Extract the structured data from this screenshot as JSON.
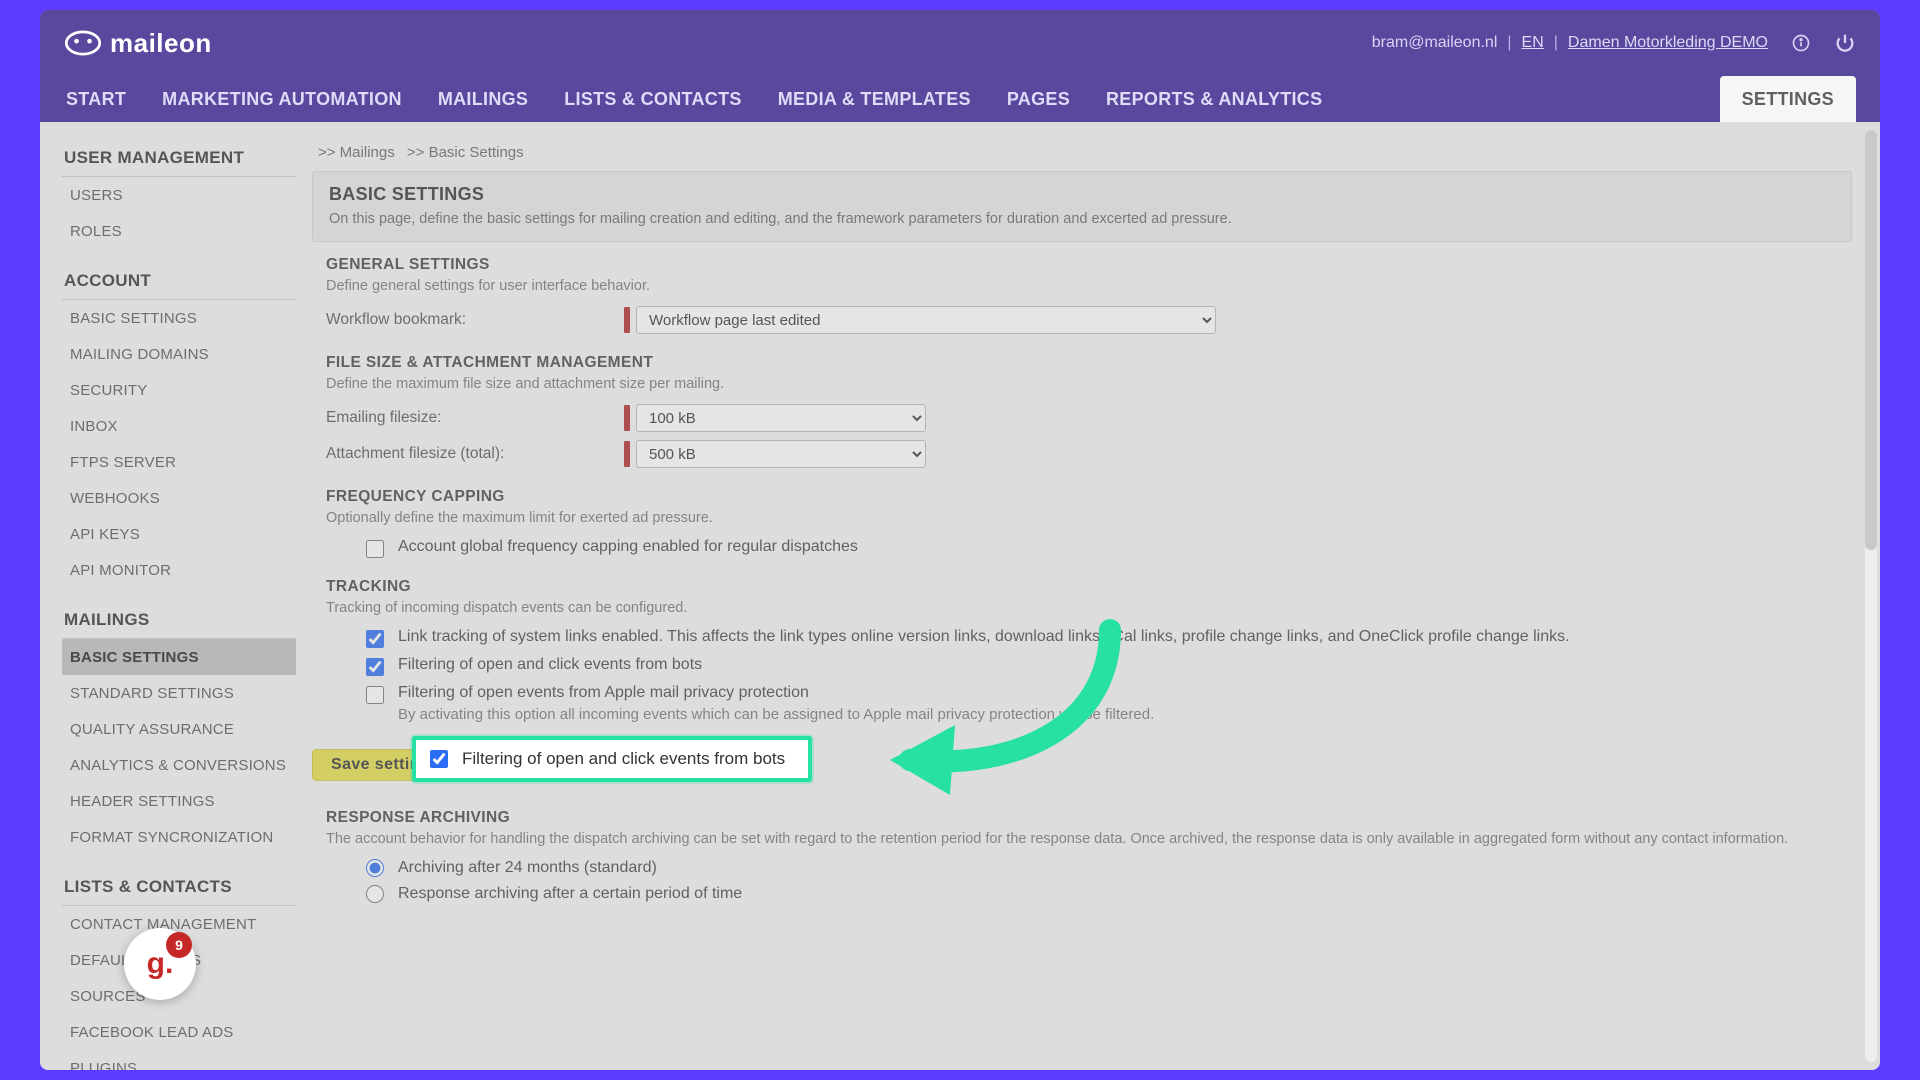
{
  "brand": {
    "name": "maileon"
  },
  "header": {
    "email": "bram@maileon.nl",
    "lang": "EN",
    "org": "Damen Motorkleding DEMO"
  },
  "nav": {
    "items": [
      "START",
      "MARKETING AUTOMATION",
      "MAILINGS",
      "LISTS & CONTACTS",
      "MEDIA & TEMPLATES",
      "PAGES",
      "REPORTS & ANALYTICS"
    ],
    "settings": "SETTINGS"
  },
  "sidebar": {
    "groups": [
      {
        "title": "USER MANAGEMENT",
        "items": [
          "USERS",
          "ROLES"
        ]
      },
      {
        "title": "ACCOUNT",
        "items": [
          "BASIC SETTINGS",
          "MAILING DOMAINS",
          "SECURITY",
          "INBOX",
          "FTPS SERVER",
          "WEBHOOKS",
          "API KEYS",
          "API MONITOR"
        ]
      },
      {
        "title": "MAILINGS",
        "items": [
          "BASIC SETTINGS",
          "STANDARD SETTINGS",
          "QUALITY ASSURANCE",
          "ANALYTICS & CONVERSIONS",
          "HEADER SETTINGS",
          "FORMAT SYNCRONIZATION"
        ],
        "active_index": 0
      },
      {
        "title": "LISTS & CONTACTS",
        "items": [
          "CONTACT MANAGEMENT",
          "DEFAULT VALUES",
          "SOURCES",
          "FACEBOOK LEAD ADS",
          "PLUGINS"
        ]
      }
    ]
  },
  "breadcrumb": {
    "a": ">> Mailings",
    "b": ">> Basic Settings"
  },
  "panel": {
    "title": "BASIC SETTINGS",
    "desc": "On this page, define the basic settings for mailing creation and editing, and the framework parameters for duration and excerted ad pressure."
  },
  "general": {
    "title": "GENERAL SETTINGS",
    "desc": "Define general settings for user interface behavior.",
    "workflow_label": "Workflow bookmark:",
    "workflow_value": "Workflow page last edited"
  },
  "filesize": {
    "title": "FILE SIZE & ATTACHMENT MANAGEMENT",
    "desc": "Define the maximum file size and attachment size per mailing.",
    "email_label": "Emailing filesize:",
    "email_value": "100 kB",
    "attach_label": "Attachment filesize (total):",
    "attach_value": "500 kB"
  },
  "freq": {
    "title": "FREQUENCY CAPPING",
    "desc": "Optionally define the maximum limit for exerted ad pressure.",
    "chk1": "Account global frequency capping enabled for regular dispatches"
  },
  "tracking": {
    "title": "TRACKING",
    "desc": "Tracking of incoming dispatch events can be configured.",
    "chk_links": "Link tracking of system links enabled. This affects the link types online version links, download links, iCal links, profile change links, and OneClick profile change links.",
    "chk_bots": "Filtering of open and click events from bots",
    "chk_apple": "Filtering of open events from Apple mail privacy protection",
    "chk_apple_sub": "By activating this option all incoming events which can be assigned to Apple mail privacy protection will be filtered."
  },
  "save_label": "Save settings",
  "archive": {
    "title": "RESPONSE ARCHIVING",
    "desc": "The account behavior for handling the dispatch archiving can be set with regard to the retention period for the response data. Once archived, the response data is only available in aggregated form without any contact information.",
    "r1": "Archiving after 24 months (standard)",
    "r2": "Response archiving after a certain period of time"
  },
  "badge": {
    "glyph": "g.",
    "count": "9"
  }
}
